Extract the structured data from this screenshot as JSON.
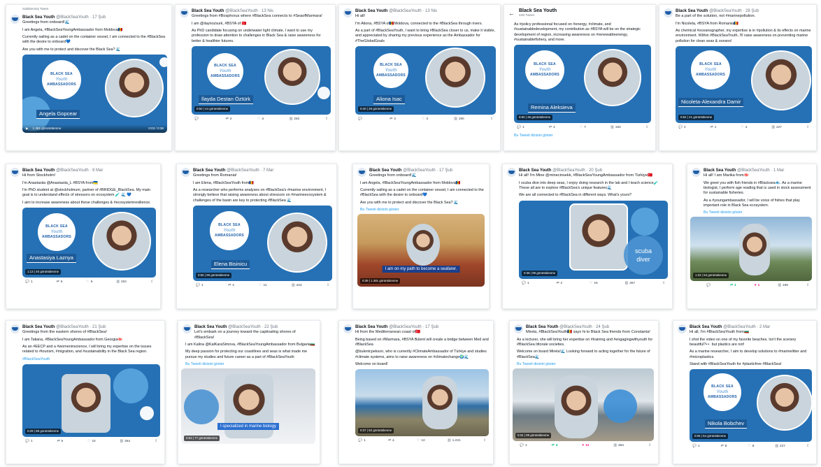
{
  "colors": {
    "brand": "#2671b5",
    "link": "#1d9bf0",
    "like": "#f91880",
    "retweet": "#00ba7c"
  },
  "icons": [
    "avatar-ship-icon",
    "reply-icon",
    "retweet-icon",
    "like-icon",
    "views-icon",
    "share-icon",
    "play-icon",
    "back-arrow-icon"
  ],
  "logo": {
    "line1": "BLACK SEA",
    "line2": "Youth",
    "line3": "AMBASSADORS"
  },
  "tweets": [
    {
      "pinned": "Sabitlenmiş Tweet",
      "name": "Black Sea Youth",
      "handle": "@BlackSeaYouth · 17 Şub",
      "lines": [
        "Greetings from onboard!🌊",
        "I am Angela, #BlackSeaYoungAmbassador from Moldova🇲🇩",
        "Currently sailing as a cadet on the container vessel, I am connected to the #BlackSea with the desire to onboard💙",
        "Are you with me to protect and discover the Black Sea? 🌊"
      ],
      "caption": "Angela Gopcear",
      "views": "1.381 görüntülenme",
      "time": "0:03 / 0:38",
      "actions": {
        "reply": "",
        "retweet": "",
        "like": "",
        "views": "",
        "share": ""
      }
    },
    {
      "name": "Black Sea Youth",
      "handle": "@BlackSeaYouth · 13 Nis",
      "lines": [
        "Greetings from #Bosphorus where #BlackSea connects to #SeaofMarmara!",
        "I am @ilaynozsurk, #BSYA of 🇹🇷",
        "As PhD candidate focusing on underwater light climate, I want to use my profession to draw attention to challenges in Black Sea & raise awareness for better & healthier futures."
      ],
      "caption": "İlayda Destan Öztürk",
      "views": "0:50 | 44 görüntülenme",
      "actions": {
        "reply": "",
        "retweet": "2",
        "like": "4",
        "views": "252",
        "share": ""
      }
    },
    {
      "name": "Black Sea Youth",
      "handle": "@BlackSeaYouth · 13 Nis",
      "lines": [
        "Hi all!",
        "I'm Aliona, #BSYA of🇲🇩Moldova, connected to the #BlackSea through rivers.",
        "As a part of #BlackSeaYouth, I want to bring #BlackSea closer to us, make it visible, and appreciated by sharing my previous experience as the Ambassador for #TheGlobalGoals"
      ],
      "caption": "Aliona Isac",
      "views": "0:40 | 29 görüntülenme",
      "actions": {
        "reply": "",
        "retweet": "3",
        "like": "3",
        "views": "190",
        "share": ""
      }
    },
    {
      "header": "Black Sea Youth",
      "count": "445 Tweet",
      "lines": [
        "As #policy professional focused on #energy, #climate, and #sustainabledevelopment, my contribution as #BSYA will be on the strategic development of region, increasing awareness on #renewableenergy, #sustainablefishery, and more."
      ],
      "caption": "Remina Aleksieva",
      "views": "0:50 | 36 görüntülenme",
      "translate": "Bu Tweeti dizisini göster",
      "actions": {
        "reply": "1",
        "retweet": "3",
        "like": "7",
        "views": "183",
        "share": ""
      }
    },
    {
      "name": "Black Sea Youth",
      "handle": "@BlackSeaYouth · 28 Şub",
      "lines": [
        "Be a part of the solution, not #marinepollution.",
        "I'm Nicoleta, #BSYA from Romania🇷🇴",
        "As chemical #oceanographer, my expertise is in #pollution & its effects on marine environment. Within #BlackSeaYouth, I'll raise awareness on preventing marine pollution for clean seas & oceans!"
      ],
      "caption": "Nicoleta-Alexandra Damir",
      "views": "0:52 | 41 görüntülenme",
      "actions": {
        "reply": "2",
        "retweet": "1",
        "like": "4",
        "views": "227",
        "share": ""
      }
    },
    {
      "name": "Black Sea Youth",
      "handle": "@BlackSeaYouth · 9 Mar",
      "lines": [
        "Hi from Stockholm!",
        "I'm Anastasiia @Anastasiia_L #BSYA from🇺🇦",
        "I'm PhD student at @stockholmuni, partner of #BRIDGE_BlackSea. My main goal is to understand effects of stressors on ecosystem 🧪 🌊 💙",
        "I aim to increase awareness about these challenges & #ecosystemresilience."
      ],
      "caption": "Anastasiya Laznya",
      "views": "1:13 | 40 görüntülenme",
      "actions": {
        "reply": "1",
        "retweet": "5",
        "like": "6",
        "views": "202",
        "share": ""
      }
    },
    {
      "name": "Black Sea Youth",
      "handle": "@BlackSeaYouth · 7 Mar",
      "lines": [
        "Greetings from Romania!",
        "I am Elena, #BlackSeaYouth from🇷🇴",
        "As a researcher who performs analyses on #BlackSea's #marine environment, I strongly believe that raising awareness about stressors on #marineecosystem & challenges of the basin are key to protecting #BlackSea 🌊"
      ],
      "caption": "Elena Bisinicu",
      "views": "0:55 | 99 görüntülenme",
      "actions": {
        "reply": "1",
        "retweet": "3",
        "like": "11",
        "views": "434",
        "share": ""
      }
    },
    {
      "name": "Black Sea Youth",
      "handle": "@BlackSeaYouth · 17 Şub",
      "lines": [
        "Greetings from onboard!🌊",
        "I am Angela, #BlackSeaYoungAmbassador from Moldova🇲🇩",
        "Currently sailing as a cadet on the container vessel, I am connected to the #BlackSea with the desire to onboard💙",
        "Are you with me to protect and discover the Black Sea? 🌊"
      ],
      "translate": "Bu Tweeti dizisini göster",
      "subtitle": "I am on my path to become a seafarer.",
      "views": "0:39 | 1.381 görüntülenme"
    },
    {
      "name": "Black Sea Youth",
      "handle": "@BlackSeaYouth · 20 Şub",
      "lines": [
        "Hi all! I'm Mine @minecinsekk, #BlackSeaYoungAmbassador from Türkiye🇹🇷",
        "I scuba dive into deep seas, I enjoy doing research in the lab and I teach science🧪 These all are to explore #BlackSea's unique features🌊",
        "We are all connected to #BlackSea in different ways. What's yours?"
      ],
      "badge": "scuba diver",
      "views": "0:38 | 99 görüntülenme",
      "actions": {
        "reply": "1",
        "retweet": "2",
        "like": "15",
        "views": "457",
        "share": ""
      }
    },
    {
      "name": "Black Sea Youth",
      "handle": "@BlackSeaYouth · 1 Mar",
      "lines": [
        "Hi all! I am Marika from🇬🇪",
        "We greet you with fish friends in #Blacksea🐟. As a marine biologist, I perform age reading that is used in stock assessment for sustainable fisheries.",
        "As a #youngambassador, I will be voice of fishes that play important role in Black Sea ecosystem."
      ],
      "translate": "Bu Tweeti dizisini göster",
      "views": "1:33 | 53 görüntülenme",
      "actions": {
        "reply": "",
        "retweet": "1",
        "like": "1",
        "views": "196",
        "share": ""
      }
    },
    {
      "name": "Black Sea Youth",
      "handle": "@BlackSeaYouth · 21 Şub",
      "lines": [
        "Greetings from the eastern shores of #BlackSea!",
        "I am Tatiana, #BlackSeaYoungAmbassador from Georgia🇬🇪",
        "As an #EECP and a #womeninscience, I will bring my expertise on the issues related to #tourism, #migration, and #sustainability in the Black Sea region.",
        "#BlackSeaYouth"
      ],
      "views": "0:29 | 88 görüntülenme",
      "actions": {
        "reply": "1",
        "retweet": "5",
        "like": "10",
        "views": "264",
        "share": ""
      }
    },
    {
      "name": "Black Sea Youth",
      "handle": "@BlackSeaYouth · 22 Şub",
      "lines": [
        "Let's embark on a journey toward the captivating shores of #BlackSea!",
        "I am Kalina @KalKaraSimova, #BlackSeaYoungAmbassador from Bulgaria🇧🇬",
        "My deep passion for protecting our coastlines and seas is what made me pursue my studies and future career as a part of #BlackSeaYouth"
      ],
      "translate": "Bu Tweeti dizisini göster",
      "subtitle": "I specialized in marine biology",
      "views": "0:53 | 77 görüntülenme"
    },
    {
      "name": "Black Sea Youth",
      "handle": "@BlackSeaYouth · 17 Şub",
      "lines": [
        "Hi from the Mediterranean coast of🇹🇷",
        "Being based on #Marmara, #BSYA Bülent will create a bridge between Med and #BlackSea",
        "@bulentcpekson, who is currently #ClimateAmbassador of Türkiye and studies #climate systems, aims to raise awareness on #climatechange🌍🌊",
        "Welcome on board!"
      ],
      "views": "0:37 | 92 görüntülenme",
      "actions": {
        "reply": "1",
        "retweet": "4",
        "like": "12",
        "views": "1.231",
        "share": ""
      }
    },
    {
      "name": "Black Sea Youth",
      "handle": "@BlackSeaYouth · 24 Şub",
      "lines": [
        "Mirela, #BlackSeaYouth🇷🇴 says hi to Black Sea friends from Constanta!",
        "As a lecturer, she will bring her expertise on #training and #engagingwithyouth for #BlackSea littorale societies.",
        "Welcome on board Mirela!🌊 Looking forward to acting together for the future of #BlackSea🌊"
      ],
      "translate": "Bu Tweeti dizisini göster",
      "views": "0:34 | 99 görüntülenme",
      "actions": {
        "reply": "1",
        "retweet": "4",
        "like": "12",
        "views": "464",
        "share": ""
      }
    },
    {
      "name": "Black Sea Youth",
      "handle": "@BlackSeaYouth · 2 Mar",
      "lines": [
        "Hi all, I'm #BlackSeaYouth from🇧🇬",
        "I shot the video on one of my favorite beaches. Isn't the scenery beautiful?👀 but plastics are not!",
        "As a marine researcher, I aim to develop solutions to #marinelitter and #microplastics.",
        "Stand with #BlackSeaYouth for #plasticfree #BlackSea!"
      ],
      "caption": "Nikola Bobchev",
      "views": "0:06 | 54 görüntülenme",
      "actions": {
        "reply": "1",
        "retweet": "8",
        "like": "8",
        "views": "227",
        "share": ""
      }
    }
  ]
}
